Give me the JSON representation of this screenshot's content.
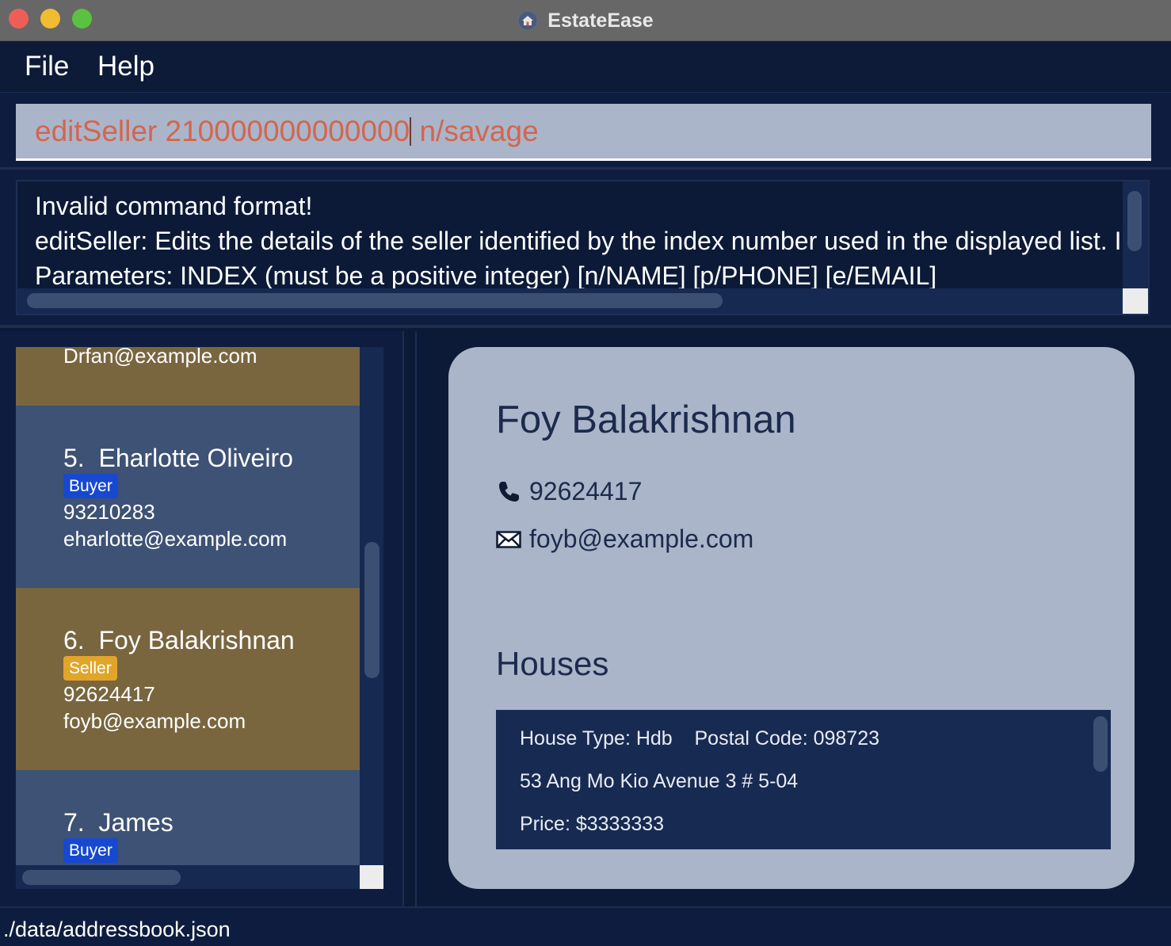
{
  "window": {
    "title": "EstateEase"
  },
  "menu": {
    "file": "File",
    "help": "Help"
  },
  "command": {
    "before_caret": "editSeller 210000000000000",
    "after_caret": " n/savage"
  },
  "result": {
    "lines": [
      "Invalid command format!",
      "editSeller: Edits the details of the seller identified by the index number used in the displayed list. I",
      "Parameters: INDEX (must be a positive integer) [n/NAME] [p/PHONE] [e/EMAIL]"
    ]
  },
  "list": {
    "cards": [
      {
        "role": "seller",
        "email": "Drfan@example.com"
      },
      {
        "role": "buyer",
        "index": "5.",
        "name": "Eharlotte Oliveiro",
        "tag": "Buyer",
        "phone": "93210283",
        "email": "eharlotte@example.com"
      },
      {
        "role": "seller",
        "index": "6.",
        "name": "Foy Balakrishnan",
        "tag": "Seller",
        "phone": "92624417",
        "email": "foyb@example.com"
      },
      {
        "role": "buyer",
        "index": "7.",
        "name": "James",
        "tag": "Buyer"
      }
    ]
  },
  "detail": {
    "name": "Foy Balakrishnan",
    "phone": "92624417",
    "email": "foyb@example.com",
    "houses_heading": "Houses",
    "house": {
      "type_line": "House Type: Hdb    Postal Code: 098723",
      "address": "53 Ang Mo Kio Avenue 3 # 5-04",
      "price": "Price: $3333333"
    }
  },
  "status": {
    "path": "./data/addressbook.json"
  },
  "colors": {
    "background": "#0c1a38",
    "seller_card": "#79663f",
    "buyer_card": "#3d5274",
    "buyer_tag": "#1748d0",
    "seller_tag": "#e0a52a",
    "command_text": "#d4654d",
    "detail_card": "#aab5c9"
  },
  "icons": [
    "home-icon",
    "phone-icon",
    "mail-icon"
  ]
}
